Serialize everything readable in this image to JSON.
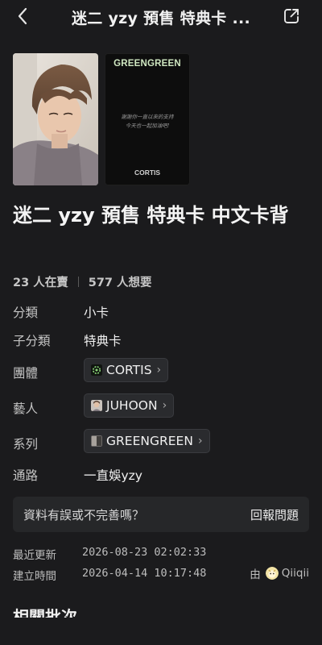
{
  "header": {
    "title": "迷二 yzy 預售 特典卡 ..."
  },
  "images": {
    "back_brand": "GREENGREEN",
    "back_message_line1": "謝謝你一直以來的支持",
    "back_message_line2": "今天也一起加油吧!",
    "back_label": "CORTIS"
  },
  "product": {
    "title": "迷二 yzy 預售 特典卡 中文卡背",
    "selling": "23 人在賣",
    "wanting": "577 人想要"
  },
  "details": {
    "category_label": "分類",
    "category_value": "小卡",
    "subcategory_label": "子分類",
    "subcategory_value": "特典卡",
    "group_label": "團體",
    "group_value": "CORTIS",
    "artist_label": "藝人",
    "artist_value": "JUHOON",
    "series_label": "系列",
    "series_value": "GREENGREEN",
    "channel_label": "通路",
    "channel_value": "一直娛yzy"
  },
  "report": {
    "question": "資料有誤或不完善嗎？",
    "link": "回報問題"
  },
  "meta": {
    "updated_label": "最近更新",
    "updated_value": "2026-08-23 02:02:33",
    "created_label": "建立時間",
    "created_value": "2026-04-14 10:17:48",
    "by": "由",
    "creator": "Qiiqii"
  },
  "sections": {
    "related_title": "相關批次"
  },
  "colors": {
    "background": "#1b1b1d",
    "chip_background": "#2a2b2e",
    "report_background": "#262729",
    "brand_green": "#cfe7c1"
  },
  "icons": {
    "back": "chevron-left-icon",
    "share": "share-icon",
    "chip_arrow": "chevron-right-icon"
  }
}
